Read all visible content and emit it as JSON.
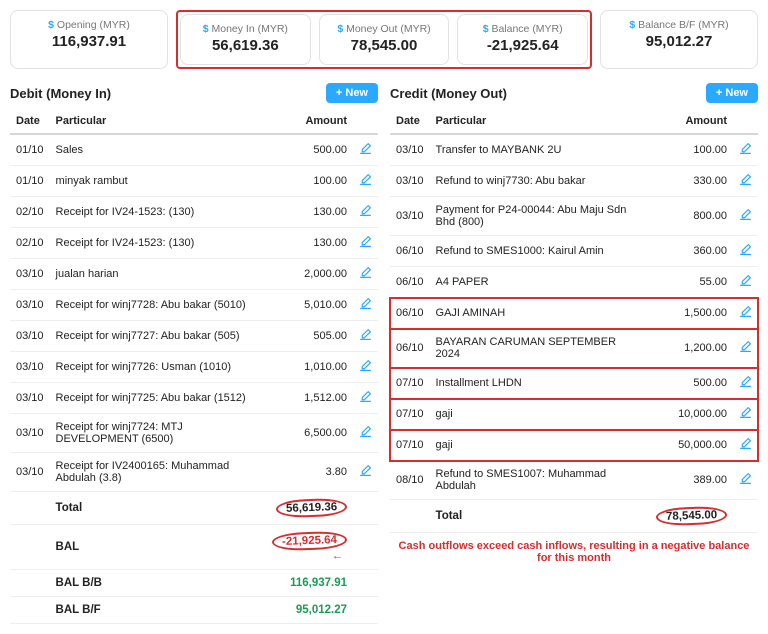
{
  "summary": {
    "opening": {
      "label": "Opening (MYR)",
      "value": "116,937.91"
    },
    "money_in": {
      "label": "Money In (MYR)",
      "value": "56,619.36"
    },
    "money_out": {
      "label": "Money Out (MYR)",
      "value": "78,545.00"
    },
    "balance": {
      "label": "Balance (MYR)",
      "value": "-21,925.64"
    },
    "balance_bf": {
      "label": "Balance B/F (MYR)",
      "value": "95,012.27"
    }
  },
  "labels": {
    "debit_title": "Debit (Money In)",
    "credit_title": "Credit (Money Out)",
    "new_btn": "+ New",
    "col_date": "Date",
    "col_particular": "Particular",
    "col_amount": "Amount",
    "total": "Total",
    "bal": "BAL",
    "bal_bb": "BAL B/B",
    "bal_bf": "BAL B/F"
  },
  "debit": {
    "rows": [
      {
        "date": "01/10",
        "particular": "Sales",
        "amount": "500.00"
      },
      {
        "date": "01/10",
        "particular": "minyak rambut",
        "amount": "100.00"
      },
      {
        "date": "02/10",
        "particular": "Receipt for IV24-1523: (130)",
        "amount": "130.00"
      },
      {
        "date": "02/10",
        "particular": "Receipt for IV24-1523: (130)",
        "amount": "130.00"
      },
      {
        "date": "03/10",
        "particular": "jualan harian",
        "amount": "2,000.00"
      },
      {
        "date": "03/10",
        "particular": "Receipt for winj7728: Abu bakar (5010)",
        "amount": "5,010.00"
      },
      {
        "date": "03/10",
        "particular": "Receipt for winj7727: Abu bakar (505)",
        "amount": "505.00"
      },
      {
        "date": "03/10",
        "particular": "Receipt for winj7726: Usman (1010)",
        "amount": "1,010.00"
      },
      {
        "date": "03/10",
        "particular": "Receipt for winj7725: Abu bakar (1512)",
        "amount": "1,512.00"
      },
      {
        "date": "03/10",
        "particular": "Receipt for winj7724: MTJ DEVELOPMENT (6500)",
        "amount": "6,500.00"
      },
      {
        "date": "03/10",
        "particular": "Receipt for IV2400165: Muhammad Abdulah (3.8)",
        "amount": "3.80"
      }
    ],
    "total": "56,619.36",
    "bal": "-21,925.64",
    "bal_bb": "116,937.91",
    "bal_bf": "95,012.27"
  },
  "credit": {
    "rows": [
      {
        "date": "03/10",
        "particular": "Transfer to MAYBANK 2U",
        "amount": "100.00",
        "hl": false
      },
      {
        "date": "03/10",
        "particular": "Refund to winj7730: Abu bakar",
        "amount": "330.00",
        "hl": false
      },
      {
        "date": "03/10",
        "particular": "Payment for P24-00044: Abu Maju Sdn Bhd (800)",
        "amount": "800.00",
        "hl": false
      },
      {
        "date": "06/10",
        "particular": "Refund to SMES1000: Kairul Amin",
        "amount": "360.00",
        "hl": false
      },
      {
        "date": "06/10",
        "particular": "A4 PAPER",
        "amount": "55.00",
        "hl": false
      },
      {
        "date": "06/10",
        "particular": "GAJI AMINAH",
        "amount": "1,500.00",
        "hl": true
      },
      {
        "date": "06/10",
        "particular": "BAYARAN CARUMAN SEPTEMBER 2024",
        "amount": "1,200.00",
        "hl": true
      },
      {
        "date": "07/10",
        "particular": "Installment LHDN",
        "amount": "500.00",
        "hl": true
      },
      {
        "date": "07/10",
        "particular": "gaji",
        "amount": "10,000.00",
        "hl": true
      },
      {
        "date": "07/10",
        "particular": "gaji",
        "amount": "50,000.00",
        "hl": true
      },
      {
        "date": "08/10",
        "particular": "Refund to SMES1007: Muhammad Abdulah",
        "amount": "389.00",
        "hl": false
      }
    ],
    "total": "78,545.00"
  },
  "annotation": {
    "text": "Cash outflows exceed cash inflows, resulting in a negative balance for this month"
  }
}
